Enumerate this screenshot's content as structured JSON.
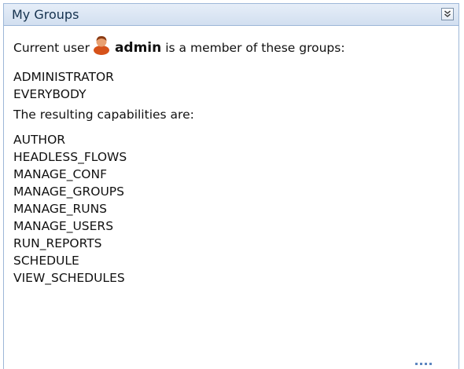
{
  "panel": {
    "title": "My Groups",
    "collapse_icon": "double-chevron-down-icon"
  },
  "user_line": {
    "prefix": "Current user",
    "user_icon": "user-icon",
    "username": "admin",
    "suffix": "is a member of these groups:"
  },
  "groups": [
    "ADMINISTRATOR",
    "EVERYBODY"
  ],
  "capabilities_heading": "The resulting capabilities are:",
  "capabilities": [
    "AUTHOR",
    "HEADLESS_FLOWS",
    "MANAGE_CONF",
    "MANAGE_GROUPS",
    "MANAGE_RUNS",
    "MANAGE_USERS",
    "RUN_REPORTS",
    "SCHEDULE",
    "VIEW_SCHEDULES"
  ],
  "colors": {
    "header_border": "#9db7d8",
    "header_text": "#15324f",
    "user_icon_body": "#d6521a",
    "user_icon_head": "#e9a070",
    "resize_dots": "#5d86c0"
  }
}
